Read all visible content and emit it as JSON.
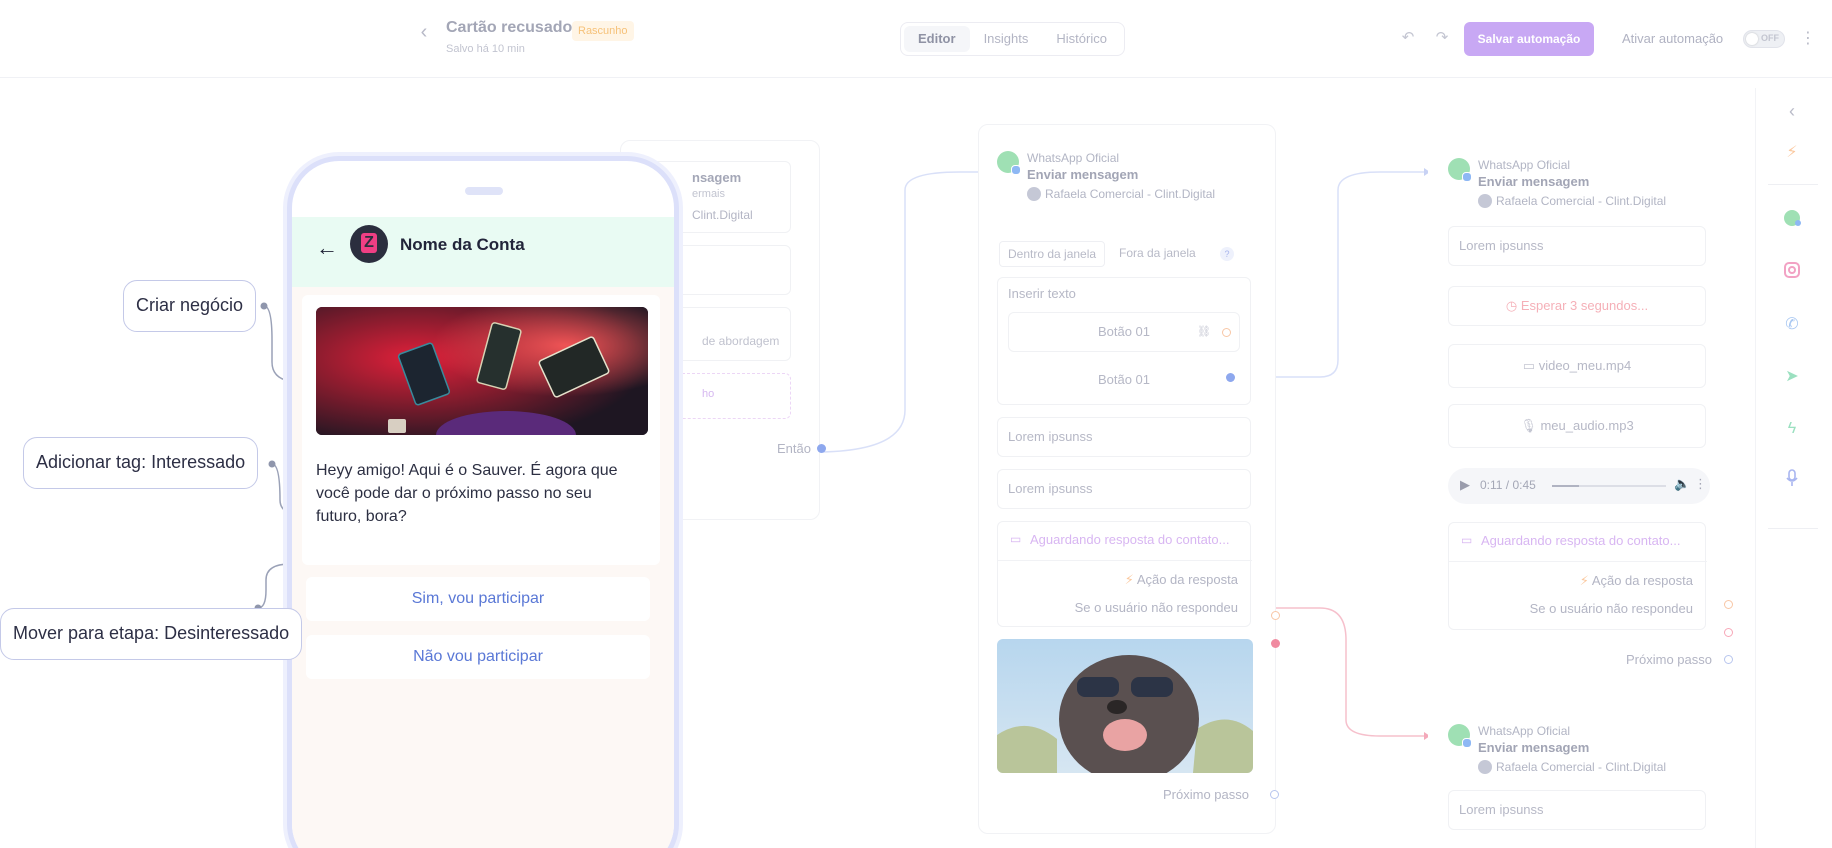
{
  "header": {
    "title": "Cartão recusado",
    "badge": "Rascunho",
    "saved": "Salvo há 10 min",
    "tabs": [
      {
        "label": "Editor",
        "active": true
      },
      {
        "label": "Insights",
        "active": false
      },
      {
        "label": "Histórico",
        "active": false
      }
    ],
    "save_label": "Salvar automação",
    "activate_label": "Ativar automação",
    "toggle_label": "OFF"
  },
  "colors": {
    "accent": "#c8a8f4",
    "whatsapp": "#9fe0b4",
    "chat_header": "#e9fbf3",
    "reply_text": "#5a78d6",
    "brand_mark": "#ef3f84"
  },
  "sidebar_icons": [
    "chevron-left-icon",
    "bolt-icon",
    "whatsapp-icon",
    "instagram-icon",
    "phone-icon",
    "send-icon",
    "bolt-icon",
    "microphone-icon"
  ],
  "phone": {
    "account_name": "Nome da Conta",
    "message": "Heyy amigo! Aqui é o Sauver. É agora que você pode dar o próximo passo no seu futuro, bora?",
    "replies": [
      "Sim, vou participar",
      "Não vou participar"
    ]
  },
  "annotations": [
    "Criar negócio",
    "Adicionar tag: Interessado",
    "Mover para etapa: Desinteressado"
  ],
  "partial_card": {
    "title": "nsagem",
    "subtitle": "ermais",
    "account": "Clint.Digital",
    "field_text": "de abordagem",
    "dashed_text": "ho",
    "then_label": "Então"
  },
  "card_center": {
    "channel": "WhatsApp Oficial",
    "action": "Enviar mensagem",
    "account": "Rafaela Comercial - Clint.Digital",
    "window_tabs": [
      "Dentro da janela",
      "Fora da janela"
    ],
    "help": "?",
    "insert_text": "Inserir texto",
    "buttons": [
      "Botão 01",
      "Botão 01"
    ],
    "fields": [
      "Lorem ipsunss",
      "Lorem ipsunss"
    ],
    "awaiting": "Aguardando resposta do contato...",
    "response_action": "Ação da resposta",
    "no_reply": "Se o usuário não respondeu",
    "next_step": "Próximo passo"
  },
  "card_right": {
    "channel": "WhatsApp Oficial",
    "action": "Enviar mensagem",
    "account": "Rafaela Comercial - Clint.Digital",
    "field": "Lorem ipsunss",
    "wait": "Esperar 3 segundos...",
    "video": "video_meu.mp4",
    "audio": "meu_audio.mp3",
    "audio_time": "0:11 / 0:45",
    "audio_progress": 0.24,
    "awaiting": "Aguardando resposta do contato...",
    "response_action": "Ação da resposta",
    "no_reply": "Se o usuário não respondeu",
    "next_step": "Próximo passo"
  },
  "card_bottom": {
    "channel": "WhatsApp Oficial",
    "action": "Enviar mensagem",
    "account": "Rafaela Comercial - Clint.Digital",
    "field": "Lorem ipsunss"
  }
}
